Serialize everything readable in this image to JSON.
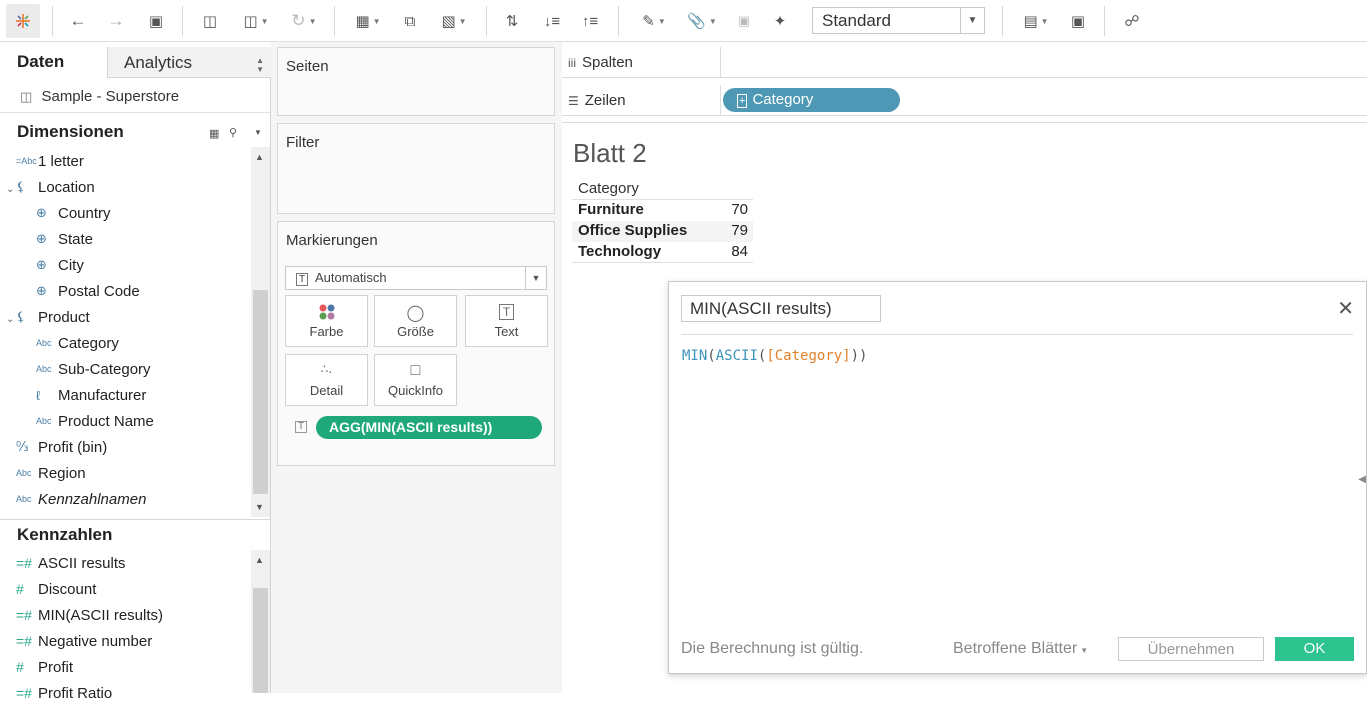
{
  "toolbar": {
    "mode_value": "Standard"
  },
  "data_pane": {
    "tab_data": "Daten",
    "tab_analytics": "Analytics",
    "datasource": "Sample - Superstore",
    "dimensions_title": "Dimensionen",
    "dimensions": [
      {
        "label": "1 letter",
        "icon": "=Abc",
        "indent": 0
      },
      {
        "label": "Location",
        "icon": "hierarchy-icon",
        "indent": 0
      },
      {
        "label": "Country",
        "icon": "globe-icon",
        "indent": 1
      },
      {
        "label": "State",
        "icon": "globe-icon",
        "indent": 1
      },
      {
        "label": "City",
        "icon": "globe-icon",
        "indent": 1
      },
      {
        "label": "Postal Code",
        "icon": "globe-icon",
        "indent": 1
      },
      {
        "label": "Product",
        "icon": "hierarchy-icon",
        "indent": 0
      },
      {
        "label": "Category",
        "icon": "Abc",
        "indent": 1
      },
      {
        "label": "Sub-Category",
        "icon": "Abc",
        "indent": 1
      },
      {
        "label": "Manufacturer",
        "icon": "paperclip-icon",
        "indent": 1
      },
      {
        "label": "Product Name",
        "icon": "Abc",
        "indent": 1
      },
      {
        "label": "Profit (bin)",
        "icon": "bin-icon",
        "indent": 0
      },
      {
        "label": "Region",
        "icon": "Abc",
        "indent": 0
      },
      {
        "label": "Kennzahlnamen",
        "icon": "Abc",
        "indent": 0
      }
    ],
    "measures_title": "Kennzahlen",
    "measures": [
      {
        "label": "ASCII results",
        "icon": "=#"
      },
      {
        "label": "Discount",
        "icon": "#"
      },
      {
        "label": "MIN(ASCII results)",
        "icon": "=#"
      },
      {
        "label": "Negative number",
        "icon": "=#"
      },
      {
        "label": "Profit",
        "icon": "#"
      },
      {
        "label": "Profit Ratio",
        "icon": "=#"
      }
    ]
  },
  "cards": {
    "pages_title": "Seiten",
    "filter_title": "Filter",
    "marks_title": "Markierungen",
    "marks_type": "Automatisch",
    "mark_buttons": [
      "Farbe",
      "Größe",
      "Text",
      "Detail",
      "QuickInfo"
    ],
    "text_pill": "AGG(MIN(ASCII results))"
  },
  "shelves": {
    "columns_label": "Spalten",
    "rows_label": "Zeilen",
    "rows_pill": "Category"
  },
  "view": {
    "sheet_title": "Blatt 2",
    "table_header": "Category",
    "rows": [
      {
        "category": "Furniture",
        "value": "70"
      },
      {
        "category": "Office Supplies",
        "value": "79"
      },
      {
        "category": "Technology",
        "value": "84"
      }
    ]
  },
  "calc_dialog": {
    "name": "MIN(ASCII results)",
    "formula_fn1": "MIN",
    "formula_fn2": "ASCII",
    "formula_field": "[Category]",
    "status": "Die Berechnung ist gültig.",
    "affected_sheets": "Betroffene Blätter",
    "apply": "Übernehmen",
    "ok": "OK"
  },
  "colors": {
    "dimension_pill": "#4e98b6",
    "measure_pill": "#1fa879",
    "ok_button": "#2ec48f",
    "formula_keyword": "#3d93bd",
    "formula_field": "#e0812c"
  }
}
